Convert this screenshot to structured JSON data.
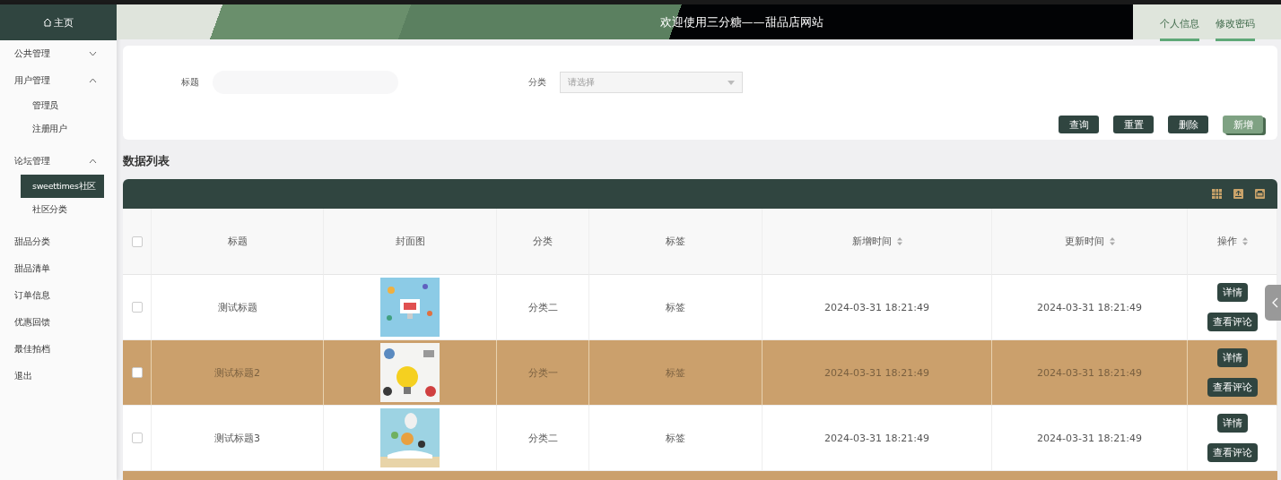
{
  "sidebar": {
    "home": "主页",
    "items": [
      {
        "label": "公共管理",
        "expanded": false
      },
      {
        "label": "用户管理",
        "expanded": true,
        "children": [
          {
            "label": "管理员",
            "selected": false
          },
          {
            "label": "注册用户",
            "selected": false
          }
        ]
      },
      {
        "label": "论坛管理",
        "expanded": true,
        "children": [
          {
            "label": "sweettimes社区",
            "selected": true
          },
          {
            "label": "社区分类",
            "selected": false
          }
        ]
      },
      {
        "label": "甜品分类"
      },
      {
        "label": "甜品清单"
      },
      {
        "label": "订单信息"
      },
      {
        "label": "优惠回馈"
      },
      {
        "label": "最佳拍档"
      },
      {
        "label": "退出"
      }
    ]
  },
  "header": {
    "title": "欢迎使用三分糖——甜品店网站",
    "links": [
      "个人信息",
      "修改密码"
    ]
  },
  "filter": {
    "fields": [
      {
        "label": "标题",
        "kind": "input"
      },
      {
        "label": "分类",
        "kind": "select",
        "placeholder": "请选择"
      }
    ],
    "buttons": [
      {
        "label": "查询",
        "hovered": false
      },
      {
        "label": "重置",
        "hovered": false
      },
      {
        "label": "删除",
        "hovered": false
      },
      {
        "label": "新增",
        "hovered": true
      }
    ]
  },
  "section_title": "数据列表",
  "table": {
    "select_all": {
      "checked": false
    },
    "columns": [
      {
        "label": "标题",
        "sortable": false
      },
      {
        "label": "封面图",
        "sortable": false
      },
      {
        "label": "分类",
        "sortable": false
      },
      {
        "label": "标签",
        "sortable": false
      },
      {
        "label": "新增时间",
        "sortable": true
      },
      {
        "label": "更新时间",
        "sortable": true
      },
      {
        "label": "操作",
        "sortable": true
      }
    ],
    "rows": [
      {
        "checked": false,
        "highlighted": false,
        "title": "测试标题",
        "cover": {
          "kind": "picture"
        },
        "category": "分类二",
        "tag": "标签",
        "created": "2024-03-31 18:21:49",
        "updated": "2024-03-31 18:21:49",
        "actions": [
          "详情",
          "查看评论"
        ]
      },
      {
        "checked": false,
        "highlighted": true,
        "title": "测试标题2",
        "cover": {
          "kind": "picture"
        },
        "category": "分类一",
        "tag": "标签",
        "created": "2024-03-31 18:21:49",
        "updated": "2024-03-31 18:21:49",
        "actions": [
          "详情",
          "查看评论"
        ]
      },
      {
        "checked": false,
        "highlighted": false,
        "title": "测试标题3",
        "cover": {
          "kind": "picture"
        },
        "category": "分类二",
        "tag": "标签",
        "created": "2024-03-31 18:21:49",
        "updated": "2024-03-31 18:21:49",
        "actions": [
          "详情",
          "查看评论"
        ]
      }
    ]
  }
}
